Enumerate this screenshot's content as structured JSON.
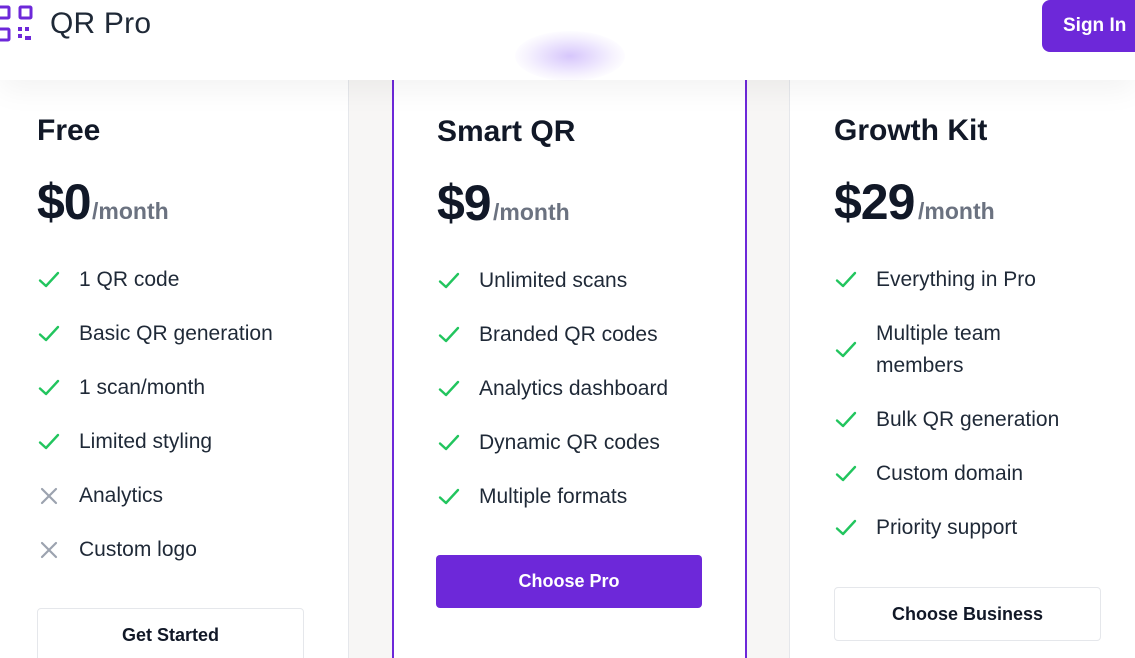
{
  "header": {
    "brand": "QR Pro",
    "sign_in": "Sign In"
  },
  "plans": [
    {
      "title": "Free",
      "price": "$0",
      "period": "/month",
      "features": [
        {
          "label": "1 QR code",
          "included": true
        },
        {
          "label": "Basic QR generation",
          "included": true
        },
        {
          "label": "1 scan/month",
          "included": true
        },
        {
          "label": "Limited styling",
          "included": true
        },
        {
          "label": "Analytics",
          "included": false
        },
        {
          "label": "Custom logo",
          "included": false
        }
      ],
      "button": "Get Started"
    },
    {
      "title": "Smart QR",
      "price": "$9",
      "period": "/month",
      "features": [
        {
          "label": "Unlimited scans",
          "included": true
        },
        {
          "label": "Branded QR codes",
          "included": true
        },
        {
          "label": "Analytics dashboard",
          "included": true
        },
        {
          "label": "Dynamic QR codes",
          "included": true
        },
        {
          "label": "Multiple formats",
          "included": true
        }
      ],
      "button": "Choose Pro"
    },
    {
      "title": "Growth Kit",
      "price": "$29",
      "period": "/month",
      "features": [
        {
          "label": "Everything in Pro",
          "included": true
        },
        {
          "label": "Multiple team members",
          "included": true
        },
        {
          "label": "Bulk QR generation",
          "included": true
        },
        {
          "label": "Custom domain",
          "included": true
        },
        {
          "label": "Priority support",
          "included": true
        }
      ],
      "button": "Choose Business"
    }
  ],
  "colors": {
    "accent": "#6d28d9",
    "check": "#22c55e",
    "cross": "#9ca3af"
  }
}
